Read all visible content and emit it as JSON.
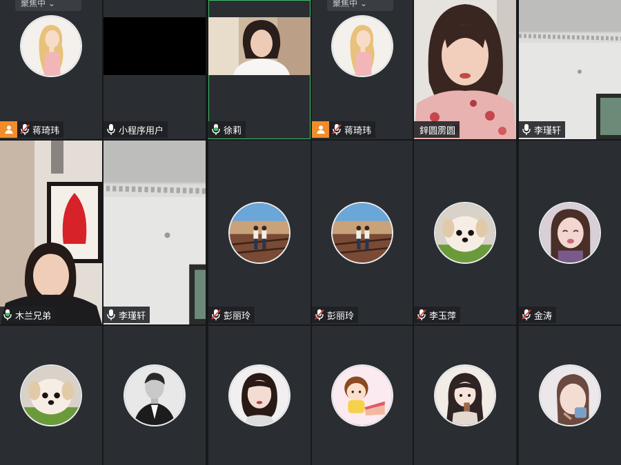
{
  "colors": {
    "tile_bg": "#2a2d31",
    "gap_bg": "#17181a",
    "host_badge": "#f08c2a",
    "active_border": "#3fbf6a",
    "mic_muted": "#e0443a",
    "mic_on": "#3fbf6a",
    "mic_idle": "#ffffff"
  },
  "tiles": [
    {
      "name": "蒋琦玮",
      "mic": "muted",
      "host": true,
      "content": "avatar-anime-girl",
      "top_chip": "聚焦中 ⌄"
    },
    {
      "name": "小程序用户",
      "mic": "idle",
      "host": false,
      "content": "black-video"
    },
    {
      "name": "徐莉",
      "mic": "on",
      "host": false,
      "active": true,
      "content": "camera-woman-home"
    },
    {
      "name": "蒋琦玮",
      "mic": "muted",
      "host": true,
      "content": "avatar-anime-girl",
      "top_chip": "聚焦中 ⌄"
    },
    {
      "name": "鋅圆雳圆",
      "mic": "none",
      "host": false,
      "content": "camera-woman-floral"
    },
    {
      "name": "李瑾轩",
      "mic": "idle",
      "host": false,
      "content": "camera-ceiling"
    },
    {
      "name": "木兰兄弟",
      "mic": "on",
      "host": false,
      "content": "camera-woman-papercut"
    },
    {
      "name": "李瑾轩",
      "mic": "idle",
      "host": false,
      "content": "camera-ceiling"
    },
    {
      "name": "彭丽玲",
      "mic": "muted",
      "host": false,
      "content": "avatar-two-girls"
    },
    {
      "name": "彭丽玲",
      "mic": "muted",
      "host": false,
      "content": "avatar-two-girls"
    },
    {
      "name": "李玉萍",
      "mic": "muted",
      "host": false,
      "content": "avatar-puppy"
    },
    {
      "name": "金涛",
      "mic": "muted",
      "host": false,
      "content": "avatar-crying-girl"
    },
    {
      "name": "",
      "mic": "none",
      "host": false,
      "content": "avatar-puppy"
    },
    {
      "name": "",
      "mic": "none",
      "host": false,
      "content": "avatar-man-suit"
    },
    {
      "name": "",
      "mic": "none",
      "host": false,
      "content": "avatar-woman-hair"
    },
    {
      "name": "",
      "mic": "none",
      "host": false,
      "content": "avatar-cartoon-cake"
    },
    {
      "name": "",
      "mic": "none",
      "host": false,
      "content": "avatar-drawn-girl"
    },
    {
      "name": "",
      "mic": "none",
      "host": false,
      "content": "avatar-child"
    }
  ]
}
